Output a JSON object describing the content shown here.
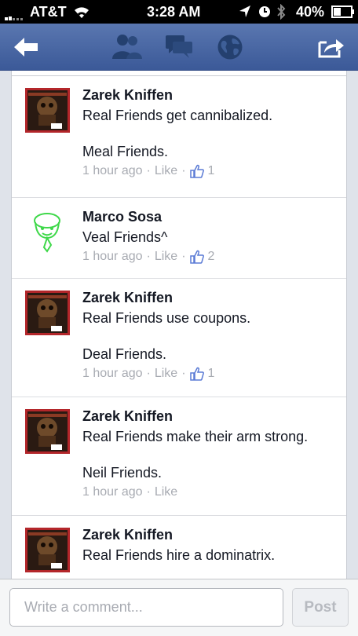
{
  "status_bar": {
    "carrier": "AT&T",
    "time": "3:28 AM",
    "battery": "40%",
    "icons": [
      "signal-icon",
      "wifi-icon",
      "location-arrow-icon",
      "clock-icon",
      "bluetooth-icon",
      "battery-icon"
    ]
  },
  "navbar": {
    "icons": [
      "back-arrow-icon",
      "friends-icon",
      "messages-icon",
      "globe-icon",
      "share-icon"
    ]
  },
  "colors": {
    "nav_blue": "#3b5998",
    "like_blue": "#5b7bd5",
    "meta_gray": "#a8abb2"
  },
  "comments": [
    {
      "author": "Zarek Kniffen",
      "text": "Real Friends get cannibalized.\n\nMeal Friends.",
      "time": "1 hour ago",
      "like_label": "Like",
      "likes": "1",
      "avatar": "album-cover-avatar"
    },
    {
      "author": "Marco Sosa",
      "text": "Veal Friends^",
      "time": "1 hour ago",
      "like_label": "Like",
      "likes": "2",
      "avatar": "green-cartoon-avatar"
    },
    {
      "author": "Zarek Kniffen",
      "text": "Real Friends use coupons.\n\nDeal Friends.",
      "time": "1 hour ago",
      "like_label": "Like",
      "likes": "1",
      "avatar": "album-cover-avatar"
    },
    {
      "author": "Zarek Kniffen",
      "text": "Real Friends make their arm strong.\n\nNeil Friends.",
      "time": "1 hour ago",
      "like_label": "Like",
      "likes": "",
      "avatar": "album-cover-avatar"
    },
    {
      "author": "Zarek Kniffen",
      "text": "Real Friends hire a dominatrix.",
      "time": "",
      "like_label": "",
      "likes": "",
      "avatar": "album-cover-avatar"
    }
  ],
  "composer": {
    "placeholder": "Write a comment...",
    "value": "",
    "post_label": "Post"
  }
}
